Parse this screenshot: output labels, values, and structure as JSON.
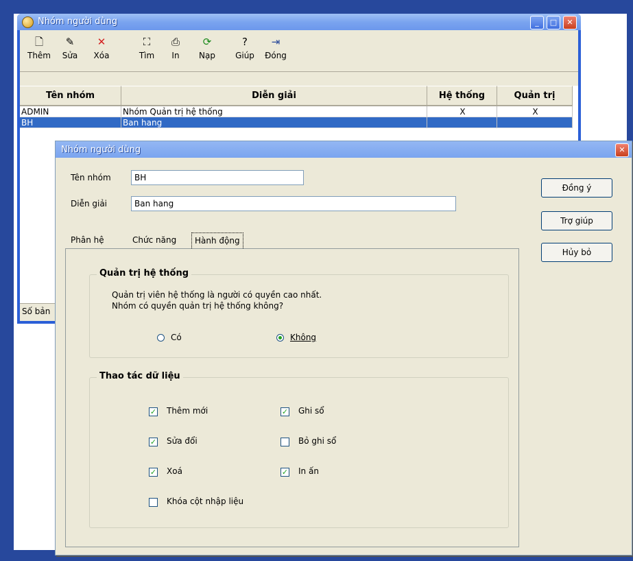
{
  "main_window": {
    "title": "Nhóm người dùng",
    "toolbar": [
      {
        "label": "Thêm",
        "icon": "new-document-icon"
      },
      {
        "label": "Sửa",
        "icon": "edit-icon"
      },
      {
        "label": "Xóa",
        "icon": "delete-x-icon"
      },
      {
        "label": "Tìm",
        "icon": "binoculars-icon"
      },
      {
        "label": "In",
        "icon": "printer-icon"
      },
      {
        "label": "Nạp",
        "icon": "refresh-icon"
      },
      {
        "label": "Giúp",
        "icon": "help-icon"
      },
      {
        "label": "Đóng",
        "icon": "exit-door-icon"
      }
    ],
    "columns": [
      "Tên nhóm",
      "Diễn giải",
      "Hệ thống",
      "Quản trị"
    ],
    "rows": [
      {
        "name": "ADMIN",
        "desc": "Nhóm Quản trị hệ thống",
        "system": "X",
        "admin": "X",
        "selected": false
      },
      {
        "name": "BH",
        "desc": "Ban hang",
        "system": "",
        "admin": "",
        "selected": true
      }
    ],
    "status": "Số bản"
  },
  "dialog": {
    "title": "Nhóm người dùng",
    "group_name_label": "Tên nhóm",
    "group_name_value": "BH",
    "desc_label": "Diễn giải",
    "desc_value": "Ban hang",
    "buttons": {
      "ok": "Đồng ý",
      "help": "Trợ giúp",
      "cancel": "Hủy bỏ"
    },
    "tabs": [
      "Phân hệ",
      "Chức năng",
      "Hành động"
    ],
    "active_tab": "Hành động",
    "admin_group": {
      "title": "Quản trị hệ thống",
      "line1": "Quản trị viên hệ thống là người có quyền cao nhất.",
      "line2": "Nhóm có quyền quản trị hệ thống không?",
      "yes": "Có",
      "no": "Không",
      "selected": "Không"
    },
    "data_group": {
      "title": "Thao tác dữ liệu",
      "options": [
        {
          "label": "Thêm mới",
          "checked": true
        },
        {
          "label": "Ghi sổ",
          "checked": true
        },
        {
          "label": "Sửa đổi",
          "checked": true
        },
        {
          "label": "Bỏ ghi sổ",
          "checked": false
        },
        {
          "label": "Xoá",
          "checked": true
        },
        {
          "label": "In ấn",
          "checked": true
        },
        {
          "label": "Khóa cột nhập liệu",
          "checked": false
        }
      ]
    }
  },
  "colors": {
    "selection": "#316ac5",
    "titlebar": "#7aa4ef",
    "desktop": "#27489c"
  }
}
